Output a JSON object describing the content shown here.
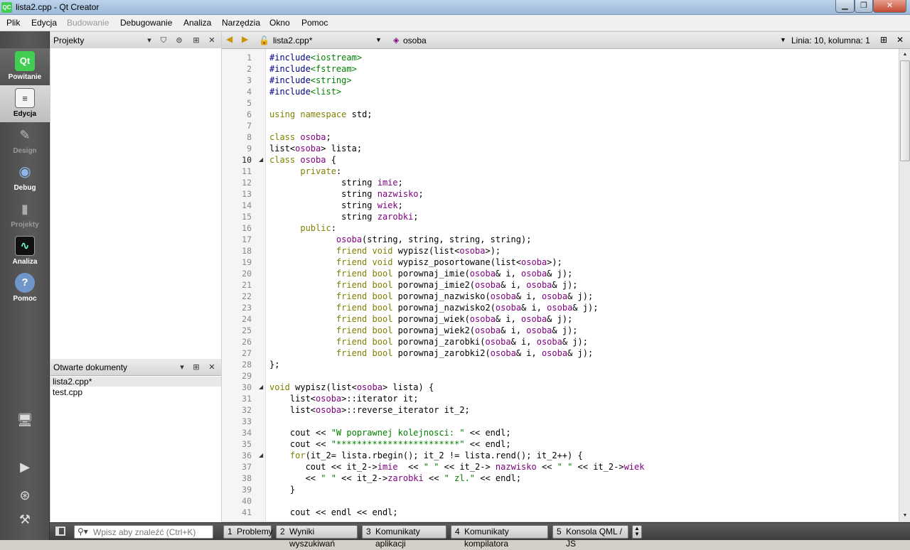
{
  "window": {
    "title": "lista2.cpp - Qt Creator",
    "app_icon": "QC"
  },
  "menu": {
    "items": [
      "Plik",
      "Edycja",
      "Budowanie",
      "Debugowanie",
      "Analiza",
      "Narzędzia",
      "Okno",
      "Pomoc"
    ],
    "disabled": [
      "Budowanie"
    ]
  },
  "modes": [
    {
      "label": "Powitanie",
      "icon": "qt-logo-icon",
      "glyph": "Qt"
    },
    {
      "label": "Edycja",
      "icon": "edit-document-icon",
      "glyph": "≡"
    },
    {
      "label": "Design",
      "icon": "design-pen-icon",
      "glyph": "✎"
    },
    {
      "label": "Debug",
      "icon": "debug-bug-icon",
      "glyph": "◉"
    },
    {
      "label": "Projekty",
      "icon": "projects-book-icon",
      "glyph": "▮"
    },
    {
      "label": "Analiza",
      "icon": "analyze-scope-icon",
      "glyph": "∿"
    },
    {
      "label": "Pomoc",
      "icon": "help-icon",
      "glyph": "?"
    }
  ],
  "projects_pane": {
    "title": "Projekty"
  },
  "open_docs_pane": {
    "title": "Otwarte dokumenty",
    "items": [
      "lista2.cpp*",
      "test.cpp"
    ]
  },
  "editor_bar": {
    "file": "lista2.cpp*",
    "symbol": "osoba",
    "position": "Linia: 10, kolumna: 1"
  },
  "editor": {
    "current_line": 10,
    "fold_lines": [
      10,
      30,
      36
    ],
    "lines": [
      "#include<iostream>",
      "#include<fstream>",
      "#include<string>",
      "#include<list>",
      "",
      "using namespace std;",
      "",
      "class osoba;",
      "list<osoba> lista;",
      "class osoba {",
      "      private:",
      "              string imie;",
      "              string nazwisko;",
      "              string wiek;",
      "              string zarobki;",
      "      public:",
      "             osoba(string, string, string, string);",
      "             friend void wypisz(list<osoba>);",
      "             friend void wypisz_posortowane(list<osoba>);",
      "             friend bool porownaj_imie(osoba& i, osoba& j);",
      "             friend bool porownaj_imie2(osoba& i, osoba& j);",
      "             friend bool porownaj_nazwisko(osoba& i, osoba& j);",
      "             friend bool porownaj_nazwisko2(osoba& i, osoba& j);",
      "             friend bool porownaj_wiek(osoba& i, osoba& j);",
      "             friend bool porownaj_wiek2(osoba& i, osoba& j);",
      "             friend bool porownaj_zarobki(osoba& i, osoba& j);",
      "             friend bool porownaj_zarobki2(osoba& i, osoba& j);",
      "};",
      "",
      "void wypisz(list<osoba> lista) {",
      "    list<osoba>::iterator it;",
      "    list<osoba>::reverse_iterator it_2;",
      "",
      "    cout << \"W poprawnej kolejnosci: \" << endl;",
      "    cout << \"************************\" << endl;",
      "    for(it_2= lista.rbegin(); it_2 != lista.rend(); it_2++) {",
      "       cout << it_2->imie  << \" \" << it_2-> nazwisko << \" \" << it_2->wiek",
      "       << \" \" << it_2->zarobki << \" zl.\" << endl;",
      "    }",
      "",
      "    cout << endl << endl;"
    ]
  },
  "bottom": {
    "search_placeholder": "Wpisz aby znaleźć (Ctrl+K)",
    "tabs": [
      {
        "num": "1",
        "label": "Problemy"
      },
      {
        "num": "2",
        "label": "Wyniki wyszukiwań"
      },
      {
        "num": "3",
        "label": "Komunikaty aplikacji"
      },
      {
        "num": "4",
        "label": "Komunikaty kompilatora"
      },
      {
        "num": "5",
        "label": "Konsola QML / JS"
      }
    ]
  }
}
